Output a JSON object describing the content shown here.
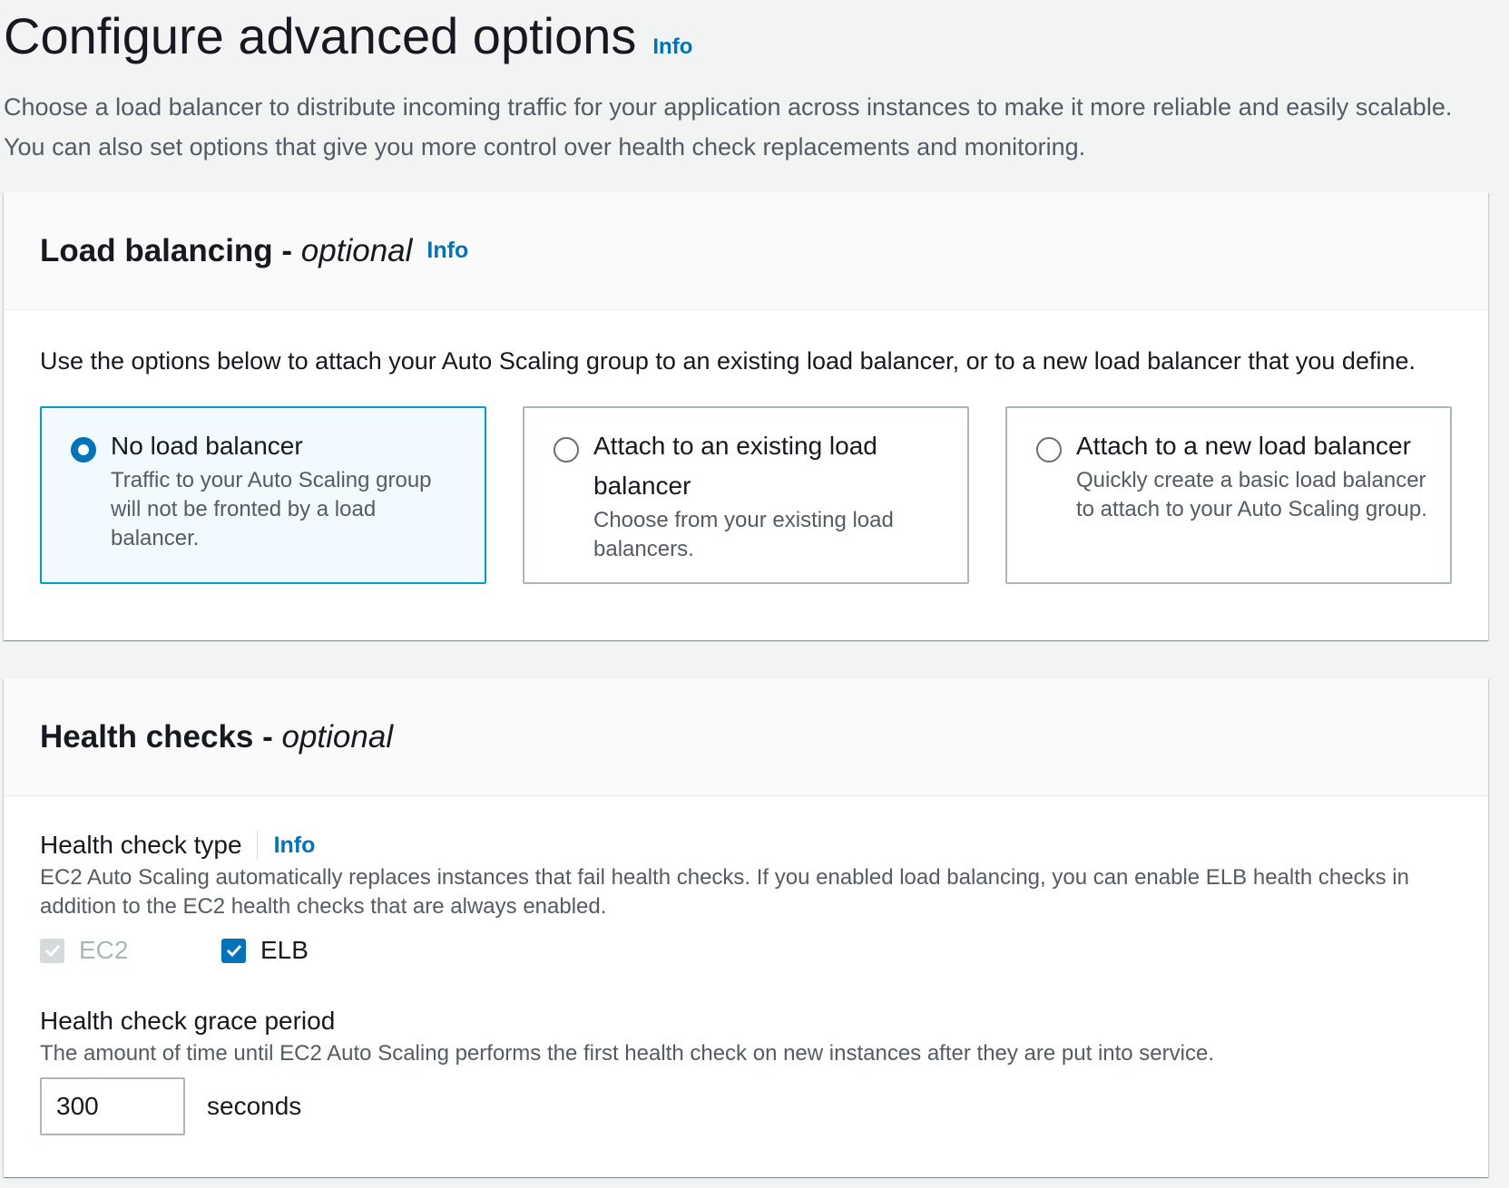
{
  "page": {
    "title": "Configure advanced options",
    "info_label": "Info",
    "description": "Choose a load balancer to distribute incoming traffic for your application across instances to make it more reliable and easily scalable. You can also set options that give you more control over health check replacements and monitoring."
  },
  "load_balancing": {
    "title": "Load balancing - ",
    "title_optional": "optional",
    "info_label": "Info",
    "description": "Use the options below to attach your Auto Scaling group to an existing load balancer, or to a new load balancer that you define.",
    "options": [
      {
        "title": "No load balancer",
        "description": "Traffic to your Auto Scaling group will not be fronted by a load balancer.",
        "selected": true
      },
      {
        "title": "Attach to an existing load balancer",
        "description": "Choose from your existing load balancers.",
        "selected": false
      },
      {
        "title": "Attach to a new load balancer",
        "description": "Quickly create a basic load balancer to attach to your Auto Scaling group.",
        "selected": false
      }
    ]
  },
  "health_checks": {
    "title": "Health checks - ",
    "title_optional": "optional",
    "type": {
      "label": "Health check type",
      "info_label": "Info",
      "description": "EC2 Auto Scaling automatically replaces instances that fail health checks. If you enabled load balancing, you can enable ELB health checks in addition to the EC2 health checks that are always enabled.",
      "ec2_label": "EC2",
      "ec2_checked": true,
      "ec2_disabled": true,
      "elb_label": "ELB",
      "elb_checked": true
    },
    "grace": {
      "label": "Health check grace period",
      "description": "The amount of time until EC2 Auto Scaling performs the first health check on new instances after they are put into service.",
      "value": "300",
      "unit": "seconds"
    }
  },
  "colors": {
    "accent": "#0073bb",
    "selected_border": "#00a1c9",
    "selected_bg": "#f1faff",
    "page_bg": "#f2f3f3"
  }
}
